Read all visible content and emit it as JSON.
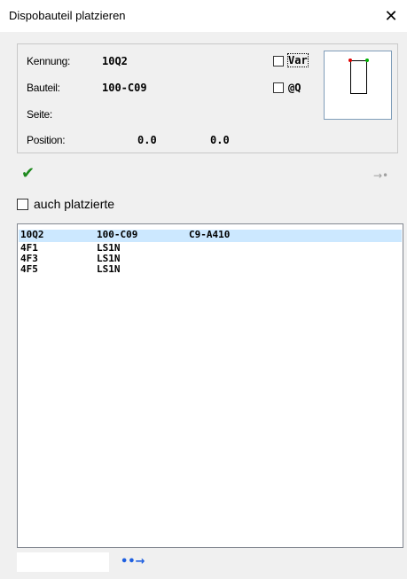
{
  "window": {
    "title": "Dispobauteil platzieren",
    "close_glyph": "✕"
  },
  "info": {
    "kennung_label": "Kennung:",
    "kennung_value": "10Q2",
    "bauteil_label": "Bauteil:",
    "bauteil_value": "100-C09",
    "seite_label": "Seite:",
    "seite_value": "",
    "position_label": "Position:",
    "position_x": "0.0",
    "position_y": "0.0"
  },
  "options": {
    "var_label": "Var",
    "var_checked": false,
    "atq_label": "@Q",
    "atq_checked": false
  },
  "actions": {
    "ok_glyph": "✔",
    "ok_icon": "green-checkmark-icon",
    "aside_glyph": "→•",
    "aside_icon": "arrow-right-icon",
    "go_glyph": "••→",
    "go_icon": "arrow-right-icon"
  },
  "filter": {
    "auch_label": "auch platzierte",
    "auch_checked": false
  },
  "list": {
    "rows": [
      {
        "kennung": "10Q2",
        "bauteil": "100-C09",
        "extra": "C9-A410",
        "selected": true
      },
      {
        "kennung": "4F1",
        "bauteil": "LS1N",
        "extra": "",
        "selected": false
      },
      {
        "kennung": "4F3",
        "bauteil": "LS1N",
        "extra": "",
        "selected": false
      },
      {
        "kennung": "4F5",
        "bauteil": "LS1N",
        "extra": "",
        "selected": false
      }
    ]
  },
  "search": {
    "value": ""
  },
  "colors": {
    "selection": "#cce8ff",
    "ok_green": "#1f8a1f",
    "go_blue": "#1e5fe0",
    "preview_red_dot": "#e00000",
    "preview_green_dot": "#00b000"
  }
}
